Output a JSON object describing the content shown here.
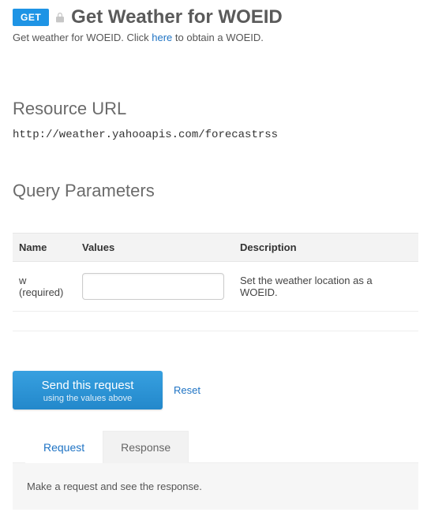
{
  "header": {
    "method": "GET",
    "title": "Get Weather for WOEID"
  },
  "description": {
    "prefix": "Get weather for WOEID. Click ",
    "link_text": "here",
    "suffix": " to obtain a WOEID."
  },
  "resource": {
    "heading": "Resource URL",
    "url": "http://weather.yahooapis.com/forecastrss"
  },
  "query": {
    "heading": "Query Parameters",
    "columns": {
      "name": "Name",
      "values": "Values",
      "description": "Description"
    },
    "rows": [
      {
        "name": "w (required)",
        "value": "",
        "description": "Set the weather location as a WOEID."
      }
    ]
  },
  "actions": {
    "send_primary": "Send this request",
    "send_secondary": "using the values above",
    "reset": "Reset"
  },
  "tabs": {
    "request": "Request",
    "response": "Response"
  },
  "panel": {
    "placeholder": "Make a request and see the response."
  }
}
